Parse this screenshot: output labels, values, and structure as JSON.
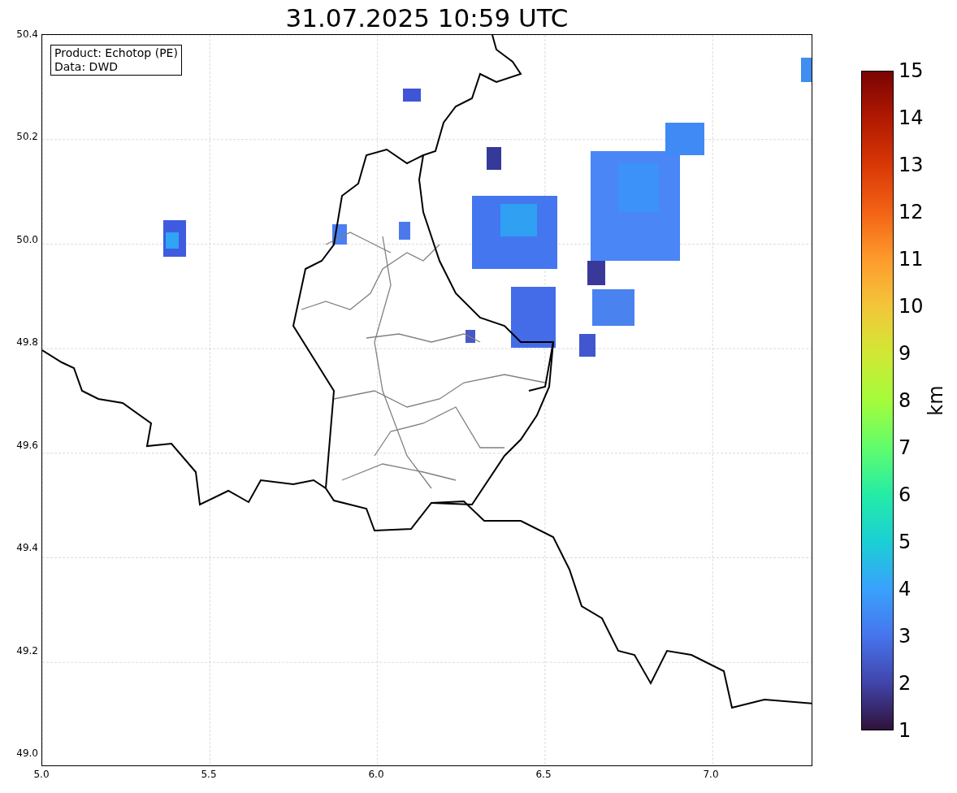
{
  "title": "31.07.2025 10:59 UTC",
  "legend": [
    "Product: Echotop (PE)",
    "Data: DWD"
  ],
  "yticks": [
    "50.4",
    "50.2",
    "50.0",
    "49.8",
    "49.6",
    "49.4",
    "49.2",
    "49.0"
  ],
  "xticks": [
    "5.0",
    "5.5",
    "6.0",
    "6.5",
    "7.0"
  ],
  "colorbar": {
    "label": "km",
    "ticks": [
      "15",
      "14",
      "13",
      "12",
      "11",
      "10",
      "9",
      "8",
      "7",
      "6",
      "5",
      "4",
      "3",
      "2",
      "1"
    ]
  }
}
